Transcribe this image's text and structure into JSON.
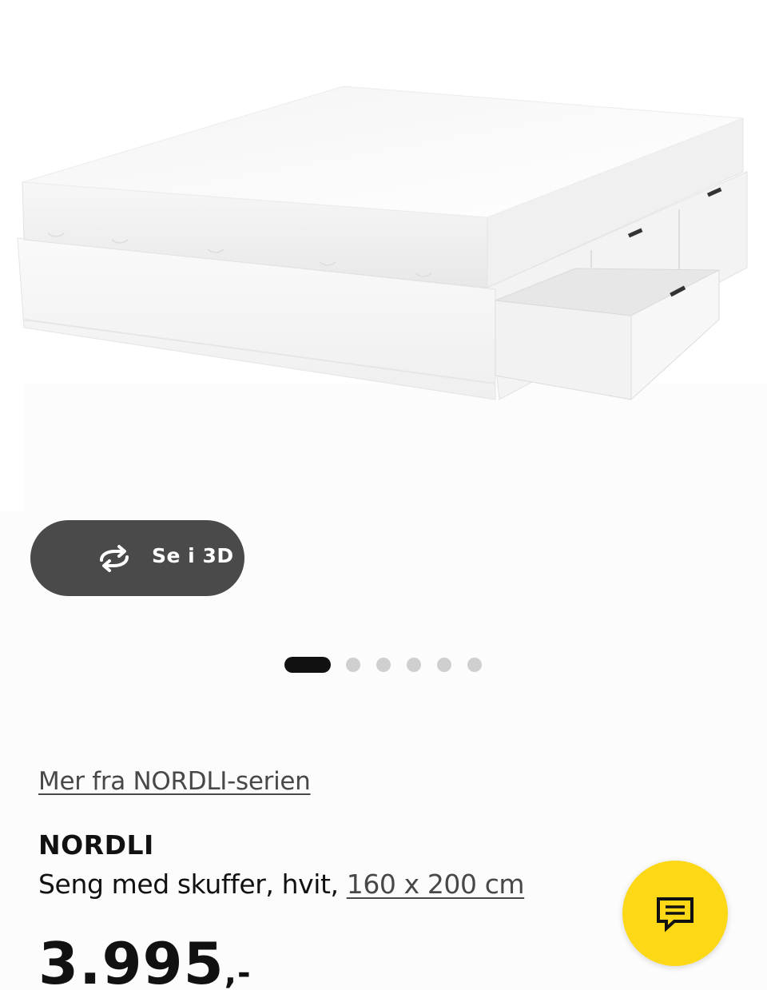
{
  "gallery": {
    "image_alt": "NORDLI seng med skuffer, hvit",
    "view_3d_label": "Se i 3D",
    "dot_count": 6,
    "active_index": 0
  },
  "product": {
    "series_link": "Mer fra NORDLI-serien",
    "name": "NORDLI",
    "description": "Seng med skuffer, hvit, ",
    "size": "160 x 200 cm",
    "price_main": "3.995",
    "price_suffix": ",-"
  },
  "colors": {
    "chat_button": "#fdd817",
    "view_3d_bg": "#4a4a4a",
    "dot_active": "#111111",
    "dot_inactive": "#cfcfcf"
  },
  "icons": {
    "view_3d": "rotate-3d-icon",
    "chat": "chat-bubble-icon"
  }
}
